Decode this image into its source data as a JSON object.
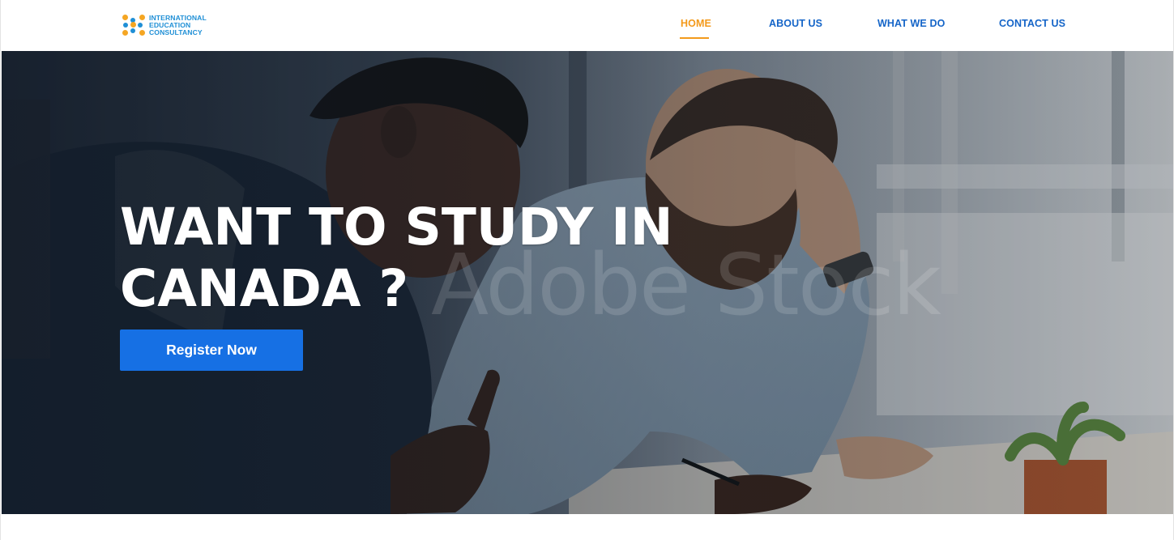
{
  "logo": {
    "line1": "INTERNATIONAL",
    "line2": "EDUCATION",
    "line3": "CONSULTANCY",
    "icon": "logo-icon",
    "colors": {
      "orange": "#f5a623",
      "blue": "#1f8fd6"
    }
  },
  "nav": {
    "items": [
      {
        "label": "HOME",
        "active": true
      },
      {
        "label": "ABOUT US",
        "active": false
      },
      {
        "label": "WHAT WE DO",
        "active": false
      },
      {
        "label": "CONTACT US",
        "active": false
      }
    ],
    "active_color": "#f39a1c",
    "color": "#1565c8"
  },
  "hero": {
    "title_line1": "WANT TO STUDY IN",
    "title_line2": "CANADA ?",
    "watermark": "Adobe Stock",
    "button_label": "Register Now",
    "button_color": "#1670e4"
  }
}
